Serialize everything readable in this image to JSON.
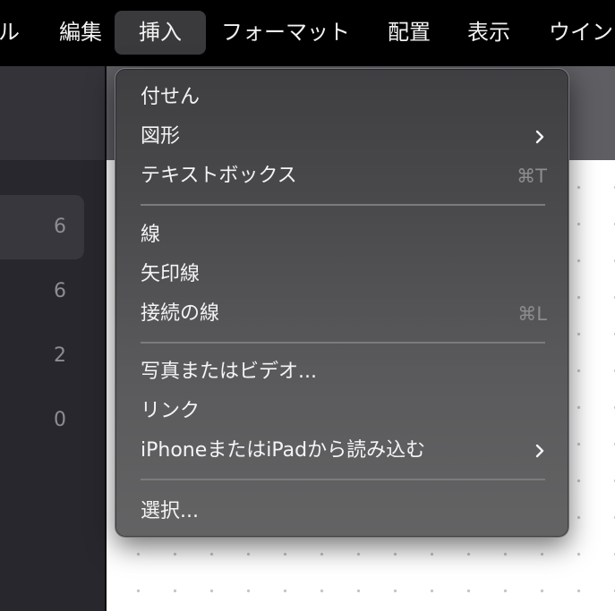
{
  "menubar": {
    "items": [
      "ル",
      "編集",
      "挿入",
      "フォーマット",
      "配置",
      "表示",
      "ウイン"
    ],
    "active_index": 2
  },
  "sidebar": {
    "counts": [
      "6",
      "6",
      "2",
      "0"
    ],
    "selected_index": 0
  },
  "insert_menu": {
    "items": [
      {
        "label": "付せん",
        "shortcut": "",
        "submenu": false
      },
      {
        "label": "図形",
        "shortcut": "",
        "submenu": true
      },
      {
        "label": "テキストボックス",
        "shortcut": "⌘T",
        "submenu": false
      },
      {
        "label": "線",
        "shortcut": "",
        "submenu": false
      },
      {
        "label": "矢印線",
        "shortcut": "",
        "submenu": false
      },
      {
        "label": "接続の線",
        "shortcut": "⌘L",
        "submenu": false
      },
      {
        "label": "写真またはビデオ...",
        "shortcut": "",
        "submenu": false
      },
      {
        "label": "リンク",
        "shortcut": "",
        "submenu": false
      },
      {
        "label": "iPhoneまたはiPadから読み込む",
        "shortcut": "",
        "submenu": true
      },
      {
        "label": "選択...",
        "shortcut": "",
        "submenu": false
      }
    ]
  },
  "icons": {
    "submenu_indicator": "chevron-right-icon",
    "command_key": "command-key-icon"
  },
  "colors": {
    "menubar_bg": "#000000",
    "menu_text": "#f4f4f5",
    "shortcut_text": "#8d8c90",
    "sidebar_bg": "#28272d",
    "canvas_bg": "#ffffff"
  }
}
